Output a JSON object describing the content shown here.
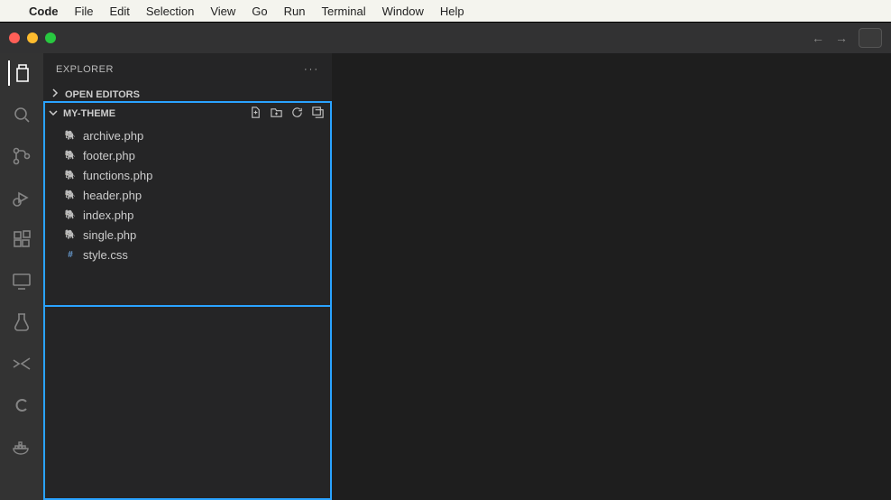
{
  "menubar": {
    "app": "Code",
    "items": [
      "File",
      "Edit",
      "Selection",
      "View",
      "Go",
      "Run",
      "Terminal",
      "Window",
      "Help"
    ]
  },
  "sidebar": {
    "title": "EXPLORER",
    "sections": {
      "open_editors": "OPEN EDITORS",
      "folder": "MY-THEME"
    },
    "files": [
      {
        "name": "archive.php",
        "type": "php"
      },
      {
        "name": "footer.php",
        "type": "php"
      },
      {
        "name": "functions.php",
        "type": "php"
      },
      {
        "name": "header.php",
        "type": "php"
      },
      {
        "name": "index.php",
        "type": "php"
      },
      {
        "name": "single.php",
        "type": "php"
      },
      {
        "name": "style.css",
        "type": "css"
      }
    ]
  }
}
